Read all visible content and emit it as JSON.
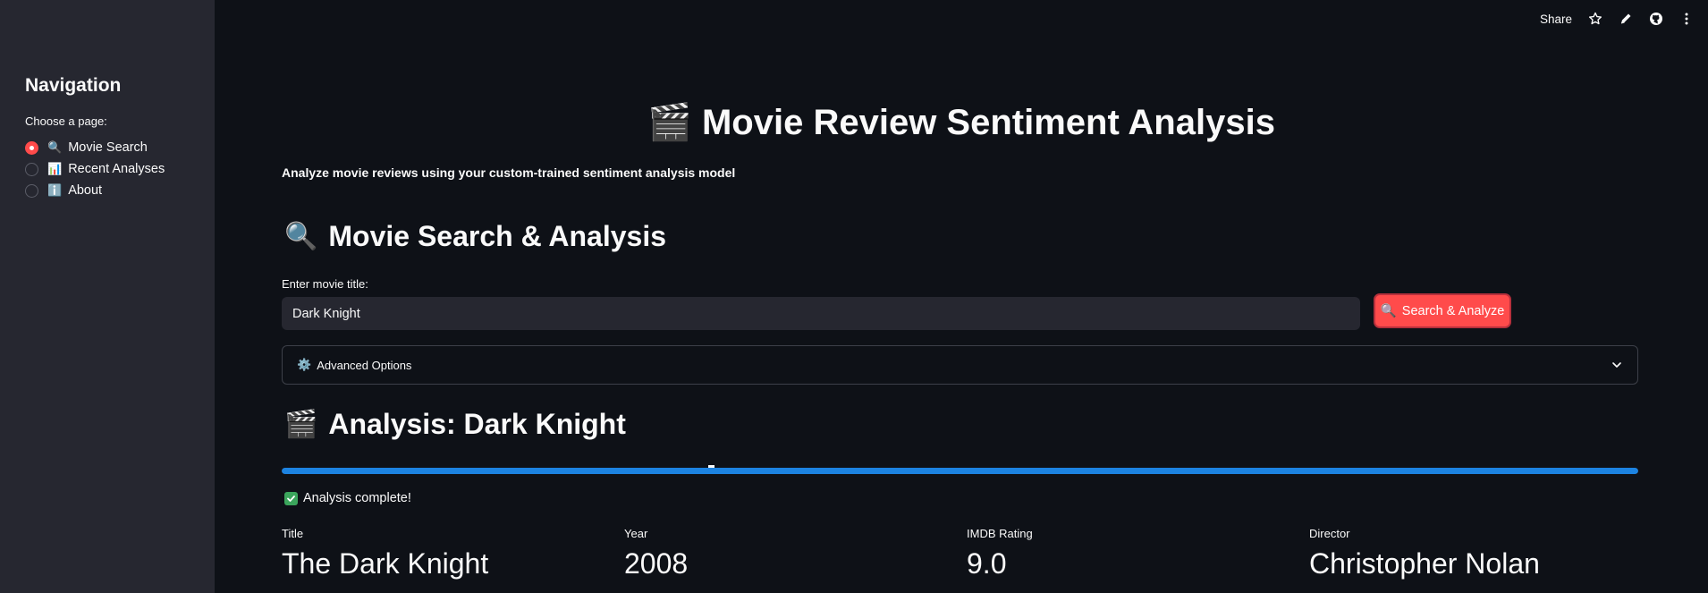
{
  "sidebar": {
    "title": "Navigation",
    "caption": "Choose a page:",
    "options": [
      {
        "emoji": "🔍",
        "label": "Movie Search",
        "selected": true
      },
      {
        "emoji": "📊",
        "label": "Recent Analyses",
        "selected": false
      },
      {
        "emoji": "ℹ️",
        "label": "About",
        "selected": false
      }
    ]
  },
  "toolbar": {
    "share_label": "Share",
    "icons": [
      "star-icon",
      "edit-icon",
      "github-icon",
      "more-vertical-icon"
    ]
  },
  "main": {
    "title_emoji": "🎬",
    "title": "Movie Review Sentiment Analysis",
    "subtitle": "Analyze movie reviews using your custom-trained sentiment analysis model",
    "search_section": {
      "emoji": "🔍",
      "heading": "Movie Search & Analysis",
      "input_label": "Enter movie title:",
      "input_value": "Dark Knight",
      "button_emoji": "🔍",
      "button_label": "Search & Analyze"
    },
    "advanced": {
      "emoji": "⚙️",
      "label": "Advanced Options"
    },
    "analysis": {
      "emoji": "🎬",
      "heading": "Analysis: Dark Knight",
      "progress": 1.0,
      "status": "Analysis complete!",
      "metrics": [
        {
          "label": "Title",
          "value": "The Dark Knight"
        },
        {
          "label": "Year",
          "value": "2008"
        },
        {
          "label": "IMDB Rating",
          "value": "9.0"
        },
        {
          "label": "Director",
          "value": "Christopher Nolan"
        }
      ]
    }
  },
  "colors": {
    "background": "#0e1117",
    "sidebar": "#262730",
    "accent": "#ff4b4b",
    "progress": "#1c83e1",
    "success": "#3ba55c"
  }
}
